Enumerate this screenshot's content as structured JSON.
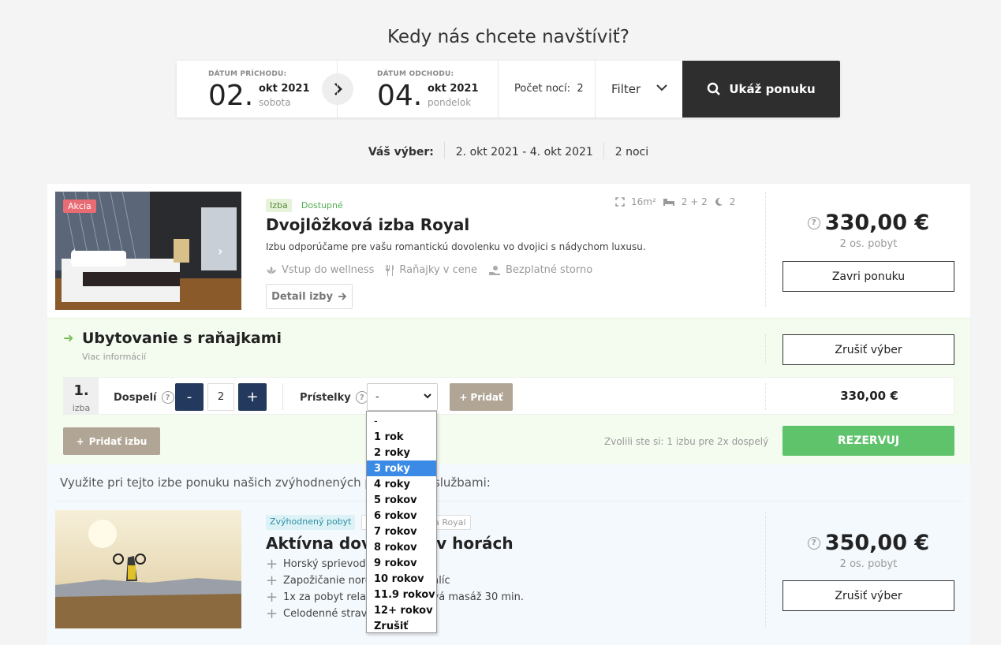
{
  "heading": "Kedy nás chcete navštíviť?",
  "search": {
    "arrival_label": "DÁTUM PRÍCHODU:",
    "arrival_day": "02.",
    "arrival_month": "okt 2021",
    "arrival_weekday": "sobota",
    "departure_label": "DÁTUM ODCHODU:",
    "departure_day": "04.",
    "departure_month": "okt 2021",
    "departure_weekday": "pondelok",
    "nights_label": "Počet nocí:",
    "nights_value": "2",
    "filter_label": "Filter",
    "search_button": "Ukáž ponuku"
  },
  "selection": {
    "label": "Váš výber:",
    "dates": "2. okt 2021 - 4. okt 2021",
    "nights": "2 noci"
  },
  "room": {
    "badge": "Akcia",
    "tag_type": "Izba",
    "tag_status": "Dostupné",
    "area": "16m²",
    "beds": "2 + 2",
    "nights": "2",
    "title": "Dvojlôžková izba Royal",
    "description": "Izbu odporúčame pre vašu romantickú dovolenku vo dvojici s nádychom luxusu.",
    "amenities": [
      "Vstup do wellness",
      "Raňajky v cene",
      "Bezplatné storno"
    ],
    "detail_button": "Detail izby",
    "price": "330,00 €",
    "price_sub": "2 os. pobyt",
    "close_button": "Zavri ponuku"
  },
  "board": {
    "title": "Ubytovanie s raňajkami",
    "more": "Viac informácií",
    "cancel_button": "Zrušiť výber",
    "room_number": "1.",
    "room_word": "izba",
    "adults_label": "Dospelí",
    "adults_minus": "-",
    "adults_value": "2",
    "adults_plus": "+",
    "children_label": "Prístelky",
    "children_select_value": "-",
    "add_button": "Pridať",
    "row_price": "330,00 €",
    "add_room_button": "Pridať izbu",
    "chosen_text": "Zvolili ste si: 1 izbu pre 2x dospelý",
    "reserve_button": "REZERVUJ"
  },
  "offers": {
    "intro": "Využite pri tejto izbe ponuku našich zvýhodnených pobytov so službami:",
    "package": {
      "tags": [
        "Zvýhodnený pobyt",
        "Dvojlôžková izba Royal"
      ],
      "title": "Aktívna dovolenka v horách",
      "items": [
        "Horský sprievodca",
        "Zapožičanie nordic walking palíc",
        "1x za pobyt relaxačná športová masáž 30 min.",
        "Celodenné stravovanie"
      ],
      "price": "350,00 €",
      "price_sub": "2 os. pobyt",
      "cancel_button": "Zrušiť výber"
    }
  },
  "dropdown": {
    "options": [
      "-",
      "1 rok",
      "2 roky",
      "3 roky",
      "4 roky",
      "5 rokov",
      "6 rokov",
      "7 rokov",
      "8 rokov",
      "9 rokov",
      "10 rokov",
      "11.9 rokov",
      "12+ rokov",
      "Zrušiť"
    ],
    "selected": "3 roky"
  },
  "colors": {
    "accent_dark": "#2e2e2e",
    "stepper": "#233a5e",
    "reserve": "#5fc36b",
    "beige_button": "#b1a696",
    "akcia_badge": "#e96b73",
    "selected_option": "#3b8ae6"
  }
}
